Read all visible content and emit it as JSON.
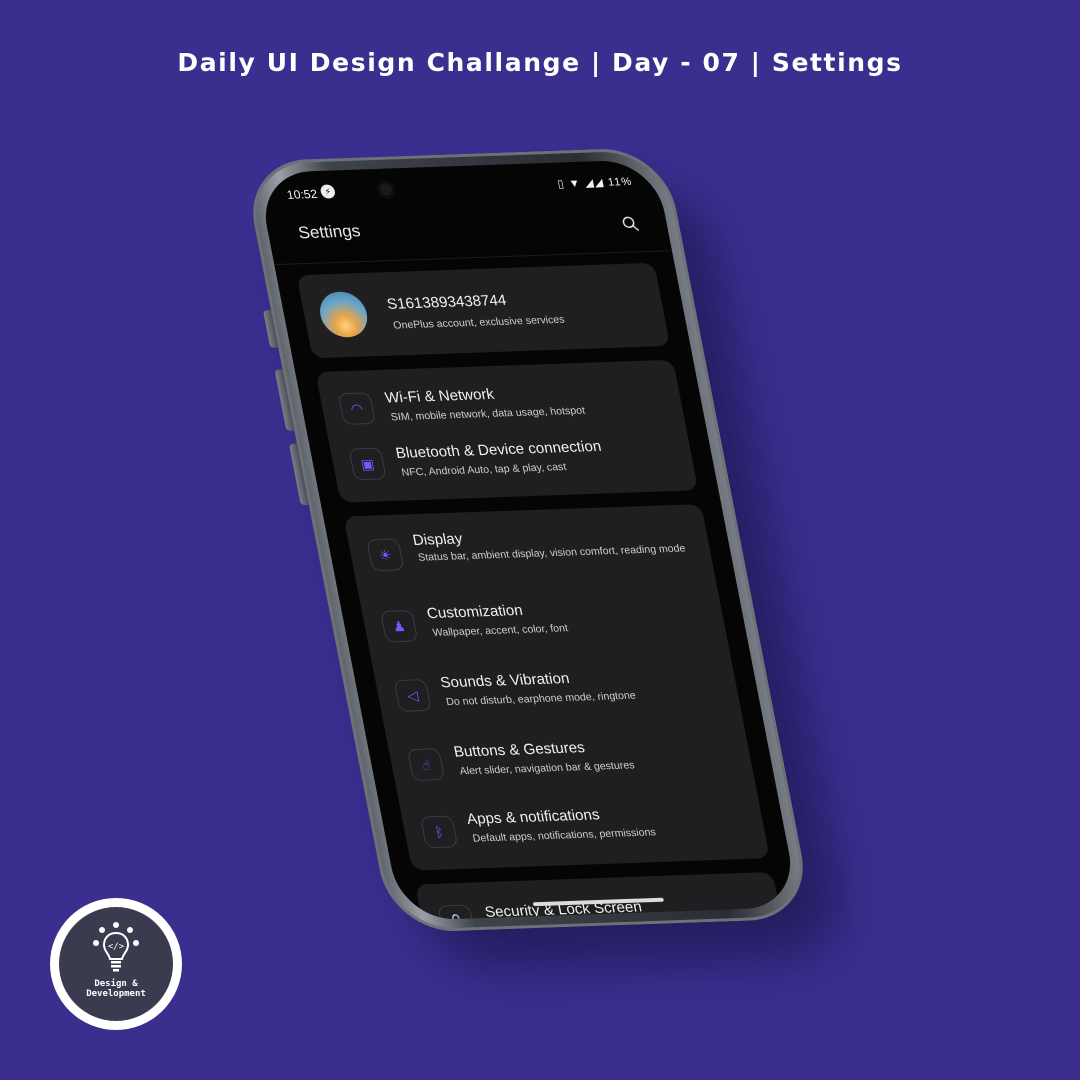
{
  "page": {
    "heading": "Daily UI Design Challange | Day - 07 | Settings",
    "colors": {
      "background": "#3a2e8f",
      "accent": "#6a5cff",
      "card": "#1f1f21"
    }
  },
  "status_bar": {
    "time": "10:52",
    "battery": "11%",
    "icons": [
      "messenger-icon",
      "vibrate-icon",
      "wifi-icon",
      "signal-icon",
      "signal-icon"
    ]
  },
  "header": {
    "title": "Settings",
    "search_icon": "search-icon"
  },
  "account": {
    "name": "S1613893438744",
    "subtitle": "OnePlus account, exclusive services"
  },
  "connectivity": [
    {
      "icon": "wifi-icon",
      "title": "Wi-Fi & Network",
      "subtitle": "SIM, mobile network, data usage, hotspot"
    },
    {
      "icon": "device-link-icon",
      "title": "Bluetooth & Device connection",
      "subtitle": "NFC, Android Auto, tap & play, cast"
    }
  ],
  "device": [
    {
      "icon": "brightness-icon",
      "title": "Display",
      "subtitle": "Status bar, ambient display, vision comfort, reading mode"
    },
    {
      "icon": "tshirt-icon",
      "title": "Customization",
      "subtitle": "Wallpaper, accent, color, font"
    },
    {
      "icon": "speaker-icon",
      "title": "Sounds & Vibration",
      "subtitle": "Do not disturb, earphone mode, ringtone"
    },
    {
      "icon": "gesture-hand-icon",
      "title": "Buttons & Gestures",
      "subtitle": "Alert slider, navigation bar & gestures"
    },
    {
      "icon": "bluetooth-icon",
      "title": "Apps & notifications",
      "subtitle": "Default apps, notifications, permissions"
    }
  ],
  "security": {
    "title": "Security & Lock Screen"
  },
  "logo": {
    "line1": "Design &",
    "line2": "Development"
  }
}
